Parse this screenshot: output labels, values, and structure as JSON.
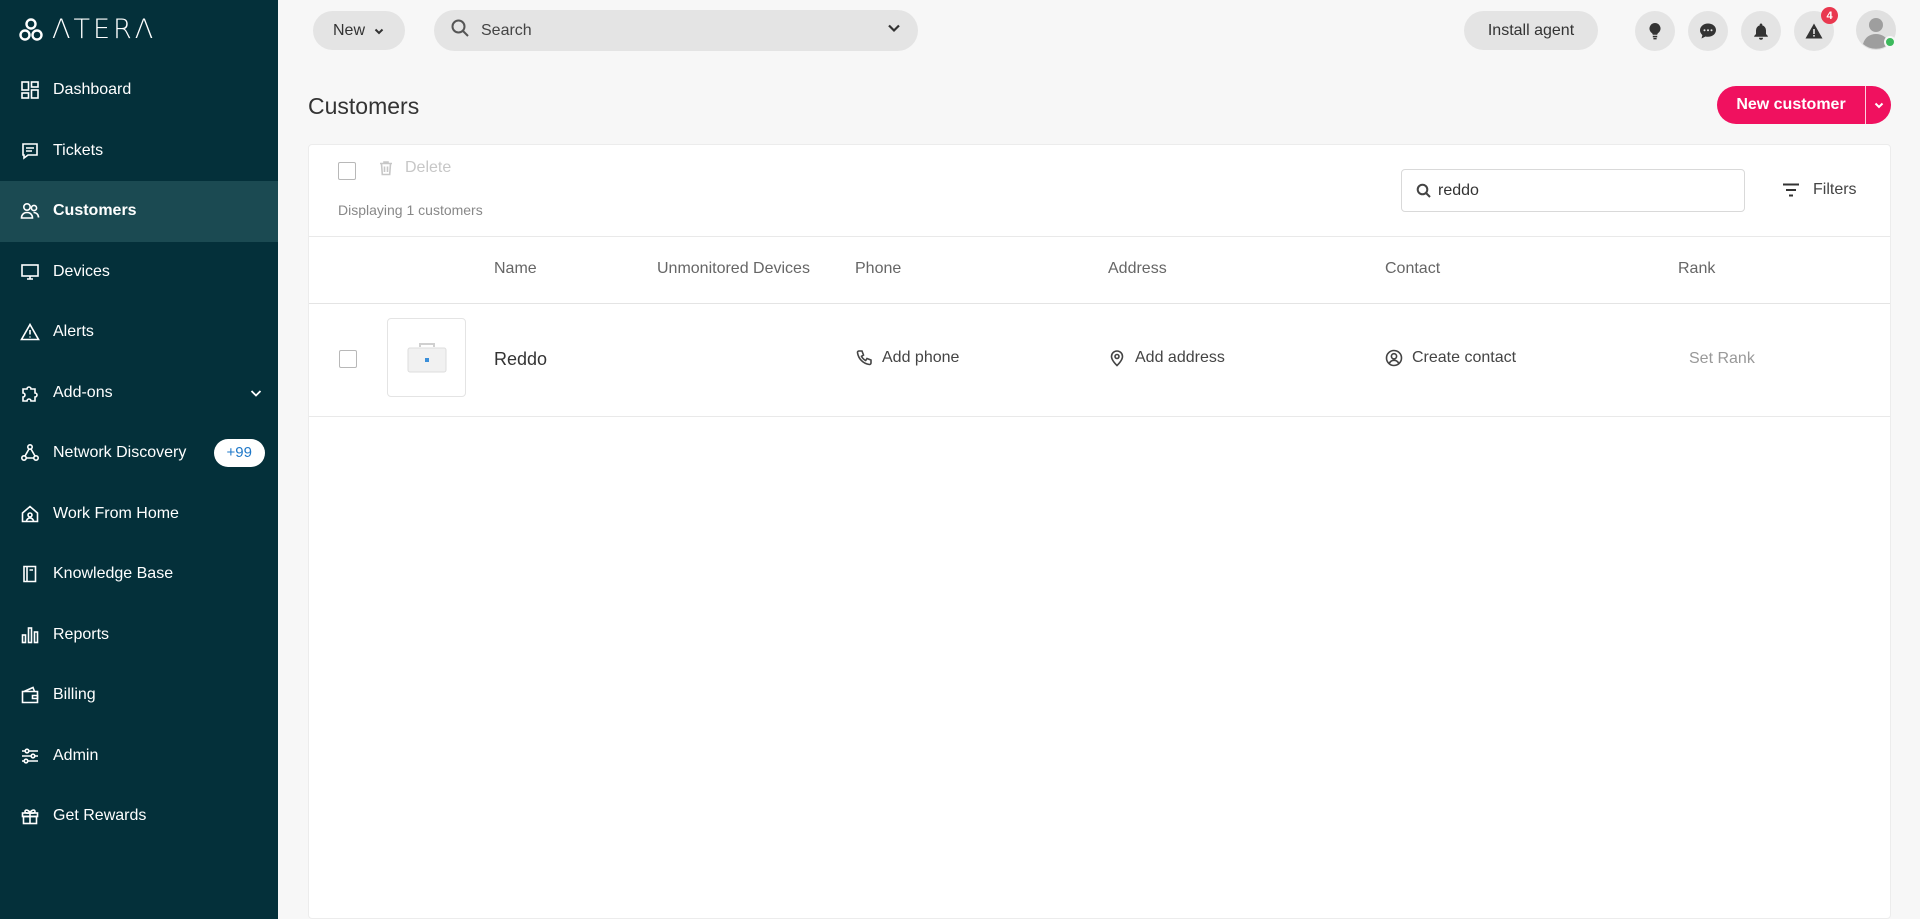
{
  "brand": {
    "name": "ΛTERΛ"
  },
  "sidebar": {
    "items": [
      {
        "label": "Dashboard",
        "icon": "dashboard-icon"
      },
      {
        "label": "Tickets",
        "icon": "tickets-icon"
      },
      {
        "label": "Customers",
        "icon": "customers-icon",
        "active": true
      },
      {
        "label": "Devices",
        "icon": "devices-icon"
      },
      {
        "label": "Alerts",
        "icon": "alerts-icon"
      },
      {
        "label": "Add-ons",
        "icon": "puzzle-icon"
      },
      {
        "label": "Network Discovery",
        "icon": "network-icon",
        "badge": "+99"
      },
      {
        "label": "Work From Home",
        "icon": "home-icon"
      },
      {
        "label": "Knowledge Base",
        "icon": "book-icon"
      },
      {
        "label": "Reports",
        "icon": "bar-chart-icon"
      },
      {
        "label": "Billing",
        "icon": "wallet-icon"
      },
      {
        "label": "Admin",
        "icon": "sliders-icon"
      },
      {
        "label": "Get Rewards",
        "icon": "gift-icon"
      }
    ]
  },
  "topbar": {
    "new_label": "New",
    "search_label": "Search",
    "install_label": "Install agent",
    "alerts_count": "4"
  },
  "page": {
    "title": "Customers",
    "new_customer_label": "New customer"
  },
  "toolbar": {
    "delete_label": "Delete",
    "count_text": "Displaying 1 customers",
    "search_value": "reddo",
    "filters_label": "Filters"
  },
  "table": {
    "columns": [
      "Name",
      "Unmonitored Devices",
      "Phone",
      "Address",
      "Contact",
      "Rank"
    ],
    "rows": [
      {
        "name": "Reddo",
        "phone": "Add phone",
        "address": "Add address",
        "contact": "Create contact",
        "rank": "Set Rank"
      }
    ]
  },
  "colors": {
    "sidebar_bg": "#04303a",
    "sidebar_active": "#1b4a52",
    "accent": "#f0115f",
    "badge_text": "#1f78c8",
    "alert_badge": "#e9384f"
  }
}
